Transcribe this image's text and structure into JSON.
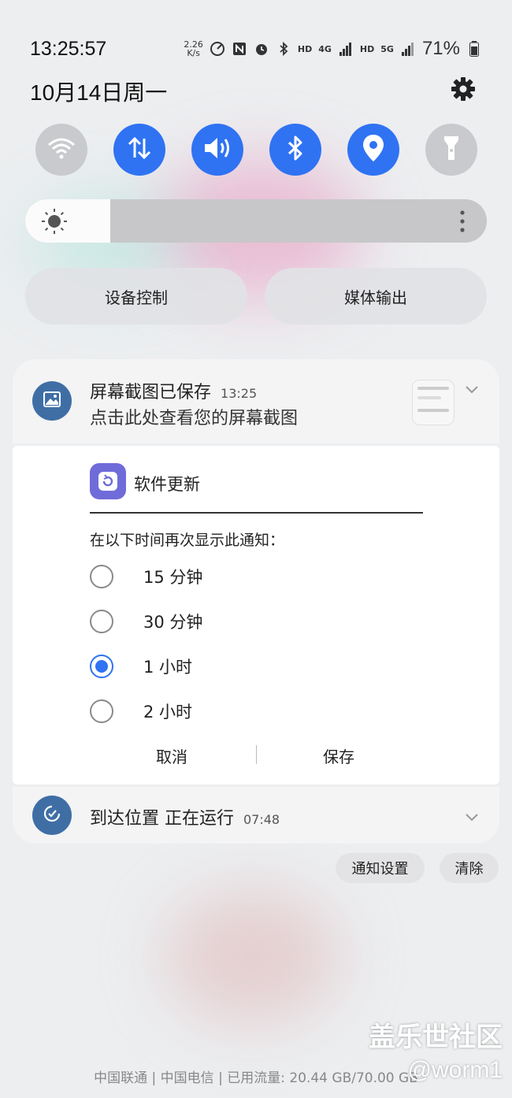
{
  "status_bar": {
    "time": "13:25:57",
    "date": "10月14日周一",
    "net_speed_value": "2.26",
    "net_speed_unit": "K/s",
    "hd1": "HD",
    "net1": "4G",
    "hd2": "HD",
    "net2": "5G",
    "battery": "71%"
  },
  "quick_settings": {
    "toggles": [
      {
        "name": "wifi",
        "state": "off"
      },
      {
        "name": "mobile-data",
        "state": "on"
      },
      {
        "name": "sound",
        "state": "on"
      },
      {
        "name": "bluetooth",
        "state": "on"
      },
      {
        "name": "location",
        "state": "on"
      },
      {
        "name": "flashlight",
        "state": "off"
      }
    ],
    "device_control": "设备控制",
    "media_output": "媒体输出"
  },
  "brightness_level": 0.185,
  "notifications": {
    "screenshot": {
      "title": "屏幕截图已保存",
      "time": "13:25",
      "body": "点击此处查看您的屏幕截图"
    },
    "snooze": {
      "app_name": "软件更新",
      "prompt": "在以下时间再次显示此通知：",
      "options": [
        "15 分钟",
        "30 分钟",
        "1 小时",
        "2 小时"
      ],
      "selected_index": 2,
      "cancel": "取消",
      "save": "保存"
    },
    "arrival": {
      "title": "到达位置 正在运行",
      "time": "07:48"
    }
  },
  "actions": {
    "notification_settings": "通知设置",
    "clear": "清除"
  },
  "footer": "中国联通 | 中国电信 | 已用流量: 20.44 GB/70.00 GB",
  "watermark": {
    "line1": "盖乐世社区",
    "line2": "@worm1"
  },
  "colors": {
    "accent": "#2f73f3",
    "toggle_off": "#c9cacd",
    "notif_icon": "#3f6ea5",
    "app_icon": "#6f6bd9"
  }
}
